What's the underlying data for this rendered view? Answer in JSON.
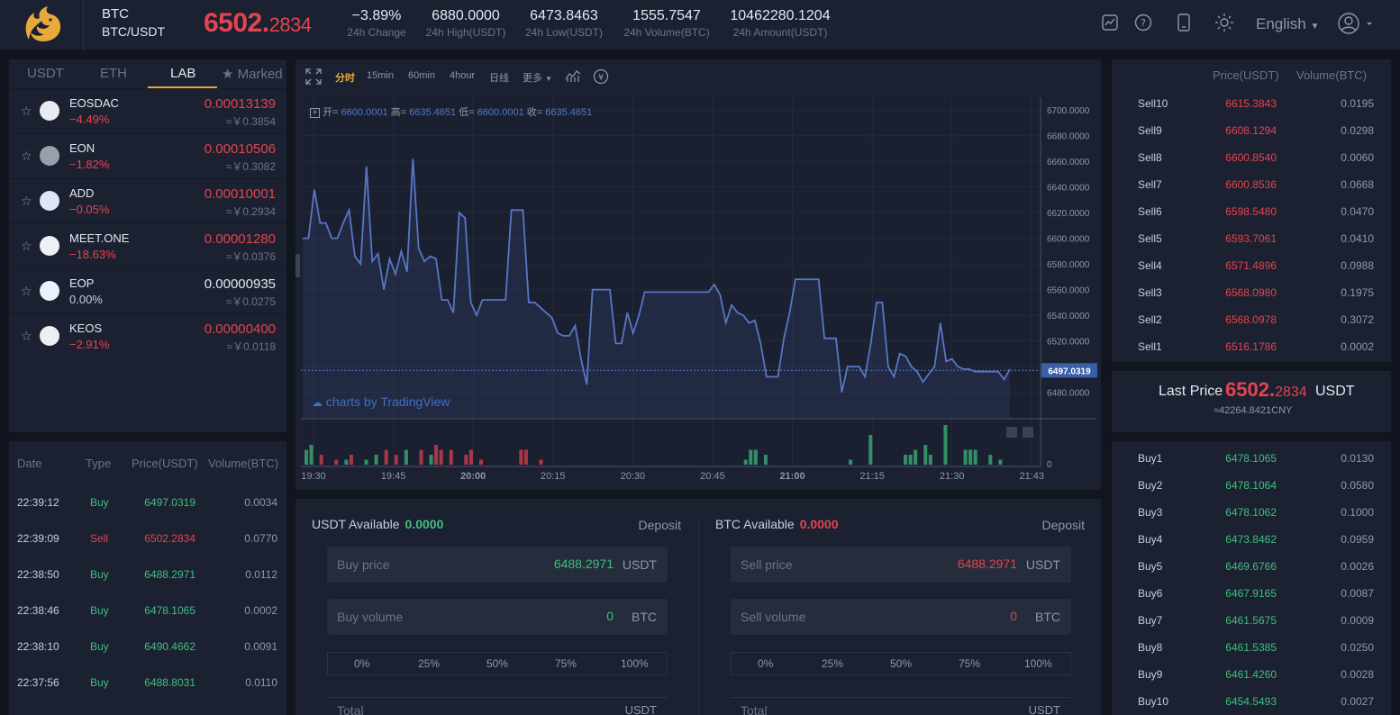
{
  "header": {
    "base": "BTC",
    "pair": "BTC/USDT",
    "price_main": "6502.",
    "price_small": "2834",
    "stats": [
      {
        "value": "−3.89%",
        "label": "24h Change"
      },
      {
        "value": "6880.0000",
        "label": "24h High(USDT)"
      },
      {
        "value": "6473.8463",
        "label": "24h Low(USDT)"
      },
      {
        "value": "1555.7547",
        "label": "24h Volume(BTC)"
      },
      {
        "value": "10462280.1204",
        "label": "24h Amount(USDT)"
      }
    ],
    "language": "English",
    "icons": [
      "chart-icon",
      "help-icon",
      "mobile-icon",
      "theme-sun-icon",
      "user-avatar-icon"
    ]
  },
  "market": {
    "tabs": [
      "USDT",
      "ETH",
      "LAB",
      "Marked"
    ],
    "active_tab": "LAB",
    "rows": [
      {
        "name": "EOSDAC",
        "change": "−4.49%",
        "dir": "down",
        "price": "0.00013139",
        "cny": "≈￥0.3854"
      },
      {
        "name": "EON",
        "change": "−1.82%",
        "dir": "down",
        "price": "0.00010506",
        "cny": "≈￥0.3082"
      },
      {
        "name": "ADD",
        "change": "−0.05%",
        "dir": "down",
        "price": "0.00010001",
        "cny": "≈￥0.2934"
      },
      {
        "name": "MEET.ONE",
        "change": "−18.63%",
        "dir": "down",
        "price": "0.00001280",
        "cny": "≈￥0.0376"
      },
      {
        "name": "EOP",
        "change": "0.00%",
        "dir": "flat",
        "price": "0.00000935",
        "cny": "≈￥0.0275"
      },
      {
        "name": "KEOS",
        "change": "−2.91%",
        "dir": "down",
        "price": "0.00000400",
        "cny": "≈￥0.0118"
      }
    ]
  },
  "trades": {
    "headers": [
      "Date",
      "Type",
      "Price(USDT)",
      "Volume(BTC)"
    ],
    "rows": [
      {
        "time": "22:39:12",
        "type": "Buy",
        "price": "6497.0319",
        "vol": "0.0034"
      },
      {
        "time": "22:39:09",
        "type": "Sell",
        "price": "6502.2834",
        "vol": "0.0770"
      },
      {
        "time": "22:38:50",
        "type": "Buy",
        "price": "6488.2971",
        "vol": "0.0112"
      },
      {
        "time": "22:38:46",
        "type": "Buy",
        "price": "6478.1065",
        "vol": "0.0002"
      },
      {
        "time": "22:38:10",
        "type": "Buy",
        "price": "6490.4662",
        "vol": "0.0091"
      },
      {
        "time": "22:37:56",
        "type": "Buy",
        "price": "6488.8031",
        "vol": "0.0110"
      }
    ]
  },
  "chart_toolbar": {
    "intervals": [
      "分时",
      "15min",
      "60min",
      "4hour",
      "日线",
      "更多"
    ],
    "active": "分时"
  },
  "chart_data": {
    "type": "line",
    "ohlc": {
      "open_label": "开=",
      "open": "6600.0001",
      "high_label": "高=",
      "high": "6635.4651",
      "low_label": "低=",
      "low": "6600.0001",
      "close_label": "收=",
      "close": "6635.4651"
    },
    "brand": "charts by TradingView",
    "ylim": [
      6460,
      6710
    ],
    "y_ticks": [
      "6700.0000",
      "6680.0000",
      "6660.0000",
      "6640.0000",
      "6620.0000",
      "6600.0000",
      "6580.0000",
      "6560.0000",
      "6540.0000",
      "6520.0000",
      "6500.0000",
      "6480.0000"
    ],
    "y_tick_values": [
      6700,
      6680,
      6660,
      6640,
      6620,
      6600,
      6580,
      6560,
      6540,
      6520,
      6500,
      6480
    ],
    "x_ticks": [
      "19:30",
      "19:45",
      "20:00",
      "20:15",
      "20:30",
      "20:45",
      "21:00",
      "21:15",
      "21:30",
      "21:43"
    ],
    "current_value_label": "6497.0319",
    "current_value": 6497.0319,
    "price_series": [
      6600,
      6600,
      6638,
      6612,
      6612,
      6600,
      6600,
      6612,
      6622,
      6586,
      6580,
      6656,
      6582,
      6588,
      6560,
      6584,
      6572,
      6590,
      6574,
      6662,
      6592,
      6582,
      6586,
      6584,
      6552,
      6552,
      6542,
      6620,
      6616,
      6550,
      6540,
      6552,
      6552,
      6552,
      6552,
      6552,
      6622,
      6622,
      6622,
      6550,
      6550,
      6546,
      6542,
      6538,
      6526,
      6524,
      6524,
      6532,
      6506,
      6486,
      6560,
      6560,
      6560,
      6560,
      6518,
      6518,
      6542,
      6526,
      6540,
      6558,
      6558,
      6558,
      6558,
      6558,
      6558,
      6558,
      6558,
      6558,
      6558,
      6558,
      6558,
      6564,
      6556,
      6534,
      6548,
      6542,
      6540,
      6534,
      6536,
      6518,
      6492,
      6492,
      6492,
      6522,
      6542,
      6568,
      6568,
      6568,
      6568,
      6568,
      6522,
      6522,
      6522,
      6480,
      6500,
      6500,
      6500,
      6492,
      6518,
      6550,
      6550,
      6500,
      6492,
      6510,
      6508,
      6500,
      6496,
      6488,
      6494,
      6500,
      6534,
      6504,
      6506,
      6500,
      6498,
      6498,
      6496,
      6496,
      6496,
      6496,
      6496,
      6490,
      6498
    ],
    "volume_series": [
      3,
      4,
      0,
      2,
      0,
      0,
      1,
      0,
      1,
      2,
      0,
      0,
      1,
      0,
      2,
      0,
      3,
      0,
      2,
      0,
      3,
      0,
      0,
      3,
      0,
      2,
      4,
      3,
      0,
      3,
      0,
      0,
      2,
      3,
      0,
      1,
      0,
      0,
      0,
      0,
      0,
      0,
      0,
      3,
      3,
      0,
      0,
      1,
      0,
      0,
      0,
      0,
      0,
      0,
      0,
      0,
      0,
      0,
      0,
      0,
      0,
      0,
      0,
      0,
      0,
      0,
      0,
      0,
      0,
      0,
      0,
      0,
      0,
      0,
      0,
      0,
      0,
      0,
      0,
      0,
      0,
      0,
      0,
      0,
      0,
      0,
      0,
      0,
      1,
      3,
      3,
      0,
      2,
      0,
      0,
      0,
      0,
      0,
      0,
      0,
      0,
      0,
      0,
      0,
      0,
      0,
      0,
      0,
      0,
      1,
      0,
      0,
      0,
      6,
      0,
      0,
      0,
      0,
      0,
      0,
      2,
      2,
      3,
      0,
      4,
      2,
      0,
      0,
      8,
      0,
      0,
      0,
      3,
      3,
      3,
      0,
      0,
      2,
      0,
      1,
      0,
      0
    ],
    "volume_up": [
      1,
      1,
      0,
      0,
      0,
      0,
      0,
      0,
      1,
      0,
      0,
      0,
      1,
      0,
      1,
      0,
      0,
      0,
      0,
      0,
      1,
      0,
      0,
      0,
      0,
      1,
      0,
      0,
      0,
      0,
      0,
      0,
      0,
      0,
      0,
      0,
      0,
      0,
      0,
      0,
      0,
      0,
      0,
      0,
      0,
      0,
      0,
      0,
      0,
      0,
      0,
      0,
      0,
      0,
      0,
      0,
      0,
      0,
      0,
      0,
      0,
      0,
      0,
      0,
      0,
      0,
      0,
      0,
      0,
      0,
      0,
      0,
      0,
      0,
      0,
      0,
      0,
      0,
      0,
      0,
      0,
      0,
      0,
      0,
      0,
      0,
      0,
      0,
      1,
      1,
      1,
      0,
      1,
      0,
      0,
      0,
      0,
      0,
      0,
      0,
      0,
      0,
      0,
      0,
      0,
      0,
      0,
      0,
      0,
      1,
      0,
      0,
      0,
      1,
      0,
      0,
      0,
      0,
      0,
      0,
      1,
      1,
      1,
      0,
      1,
      1,
      0,
      0,
      1,
      0,
      0,
      0,
      1,
      1,
      1,
      0,
      0,
      1,
      0,
      1,
      0,
      0
    ],
    "volume_zero_label": "0"
  },
  "trade_form": {
    "buy": {
      "avail_label": "USDT Available",
      "avail": "0.0000",
      "deposit": "Deposit",
      "price_ph": "Buy price",
      "price": "6488.2971",
      "price_unit": "USDT",
      "vol_ph": "Buy volume",
      "vol": "0",
      "vol_unit": "BTC",
      "total_ph": "Total",
      "total_unit": "USDT"
    },
    "sell": {
      "avail_label": "BTC Available",
      "avail": "0.0000",
      "deposit": "Deposit",
      "price_ph": "Sell price",
      "price": "6488.2971",
      "price_unit": "USDT",
      "vol_ph": "Sell volume",
      "vol": "0",
      "vol_unit": "BTC",
      "total_ph": "Total",
      "total_unit": "USDT"
    },
    "percents": [
      "0%",
      "25%",
      "50%",
      "75%",
      "100%"
    ]
  },
  "orderbook": {
    "headers": [
      "Price(USDT)",
      "Volume(BTC)"
    ],
    "asks": [
      {
        "label": "Sell10",
        "price": "6615.3843",
        "vol": "0.0195"
      },
      {
        "label": "Sell9",
        "price": "6608.1294",
        "vol": "0.0298"
      },
      {
        "label": "Sell8",
        "price": "6600.8540",
        "vol": "0.0060"
      },
      {
        "label": "Sell7",
        "price": "6600.8536",
        "vol": "0.0668"
      },
      {
        "label": "Sell6",
        "price": "6598.5480",
        "vol": "0.0470"
      },
      {
        "label": "Sell5",
        "price": "6593.7061",
        "vol": "0.0410"
      },
      {
        "label": "Sell4",
        "price": "6571.4896",
        "vol": "0.0988"
      },
      {
        "label": "Sell3",
        "price": "6568.0980",
        "vol": "0.1975"
      },
      {
        "label": "Sell2",
        "price": "6568.0978",
        "vol": "0.3072"
      },
      {
        "label": "Sell1",
        "price": "6516.1786",
        "vol": "0.0002"
      }
    ],
    "last": {
      "label": "Last Price",
      "main": "6502.",
      "small": "2834",
      "unit": "USDT",
      "cny": "≈42264.8421CNY"
    },
    "bids": [
      {
        "label": "Buy1",
        "price": "6478.1065",
        "vol": "0.0130"
      },
      {
        "label": "Buy2",
        "price": "6478.1064",
        "vol": "0.0580"
      },
      {
        "label": "Buy3",
        "price": "6478.1062",
        "vol": "0.1000"
      },
      {
        "label": "Buy4",
        "price": "6473.8462",
        "vol": "0.0959"
      },
      {
        "label": "Buy5",
        "price": "6469.6766",
        "vol": "0.0026"
      },
      {
        "label": "Buy6",
        "price": "6467.9165",
        "vol": "0.0087"
      },
      {
        "label": "Buy7",
        "price": "6461.5675",
        "vol": "0.0009"
      },
      {
        "label": "Buy8",
        "price": "6461.5385",
        "vol": "0.0250"
      },
      {
        "label": "Buy9",
        "price": "6461.4260",
        "vol": "0.0028"
      },
      {
        "label": "Buy10",
        "price": "6454.5493",
        "vol": "0.0027"
      }
    ]
  },
  "colors": {
    "up": "#3fbf7f",
    "down": "#e5434f",
    "accent": "#e6a93a",
    "line": "#5876c4"
  }
}
